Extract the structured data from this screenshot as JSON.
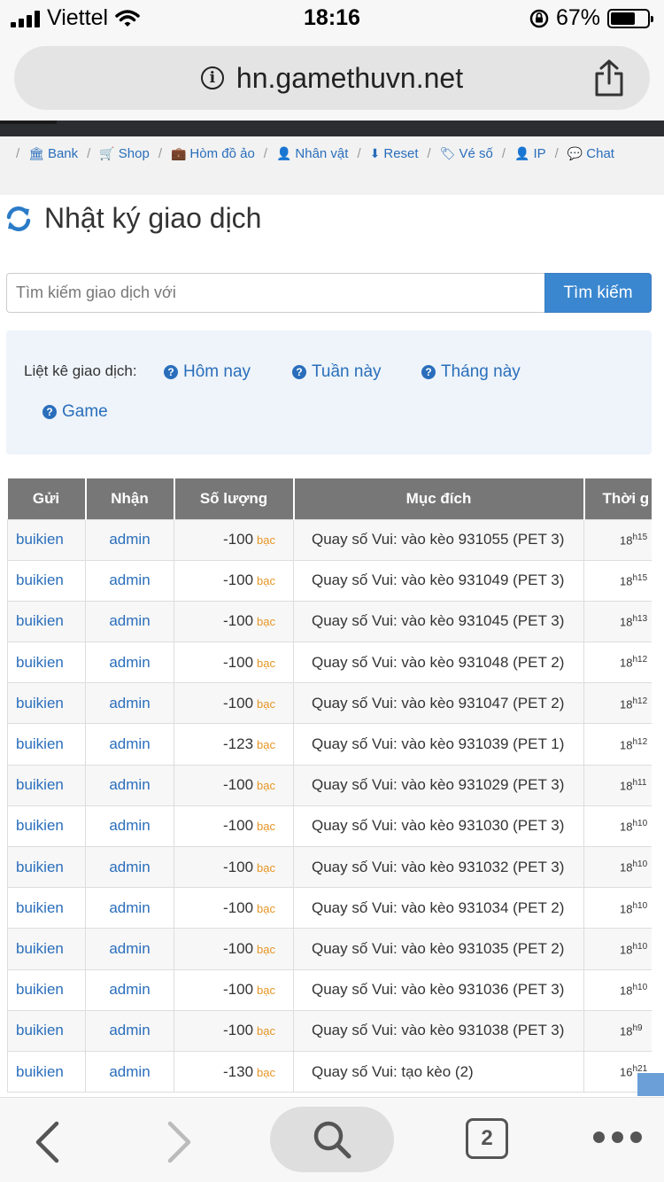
{
  "status": {
    "carrier": "Viettel",
    "time": "18:16",
    "battery_text": "67%",
    "battery_level": 0.67
  },
  "browser": {
    "url": "hn.gamethuvn.net",
    "tab_count": "2"
  },
  "nav": {
    "items": [
      {
        "label": "Bank",
        "icon": "bank-icon"
      },
      {
        "label": "Shop",
        "icon": "cart-icon"
      },
      {
        "label": "Hòm đồ ảo",
        "icon": "briefcase-icon"
      },
      {
        "label": "Nhân vật",
        "icon": "user-icon"
      },
      {
        "label": "Reset",
        "icon": "reset-icon"
      },
      {
        "label": "Vé số",
        "icon": "ticket-icon"
      },
      {
        "label": "IP",
        "icon": "ip-icon"
      },
      {
        "label": "Chat",
        "icon": "chat-icon"
      }
    ]
  },
  "page": {
    "title": "Nhật ký giao dịch"
  },
  "search": {
    "placeholder": "Tìm kiếm giao dịch với",
    "button_label": "Tìm kiếm"
  },
  "filter": {
    "label": "Liệt kê giao dịch:",
    "links": [
      "Hôm nay",
      "Tuần này",
      "Tháng này",
      "Game"
    ]
  },
  "table": {
    "headers": [
      "Gửi",
      "Nhận",
      "Số lượng",
      "Mục đích",
      "Thời g"
    ],
    "unit": "bạc",
    "rows": [
      {
        "from": "buikien",
        "to": "admin",
        "amount": "-100",
        "purpose": "Quay số Vui: vào kèo 931055 (PET 3)",
        "time_h": "18",
        "time_m": "15"
      },
      {
        "from": "buikien",
        "to": "admin",
        "amount": "-100",
        "purpose": "Quay số Vui: vào kèo 931049 (PET 3)",
        "time_h": "18",
        "time_m": "15"
      },
      {
        "from": "buikien",
        "to": "admin",
        "amount": "-100",
        "purpose": "Quay số Vui: vào kèo 931045 (PET 3)",
        "time_h": "18",
        "time_m": "13"
      },
      {
        "from": "buikien",
        "to": "admin",
        "amount": "-100",
        "purpose": "Quay số Vui: vào kèo 931048 (PET 2)",
        "time_h": "18",
        "time_m": "12"
      },
      {
        "from": "buikien",
        "to": "admin",
        "amount": "-100",
        "purpose": "Quay số Vui: vào kèo 931047 (PET 2)",
        "time_h": "18",
        "time_m": "12"
      },
      {
        "from": "buikien",
        "to": "admin",
        "amount": "-123",
        "purpose": "Quay số Vui: vào kèo 931039 (PET 1)",
        "time_h": "18",
        "time_m": "12"
      },
      {
        "from": "buikien",
        "to": "admin",
        "amount": "-100",
        "purpose": "Quay số Vui: vào kèo 931029 (PET 3)",
        "time_h": "18",
        "time_m": "11"
      },
      {
        "from": "buikien",
        "to": "admin",
        "amount": "-100",
        "purpose": "Quay số Vui: vào kèo 931030 (PET 3)",
        "time_h": "18",
        "time_m": "10"
      },
      {
        "from": "buikien",
        "to": "admin",
        "amount": "-100",
        "purpose": "Quay số Vui: vào kèo 931032 (PET 3)",
        "time_h": "18",
        "time_m": "10"
      },
      {
        "from": "buikien",
        "to": "admin",
        "amount": "-100",
        "purpose": "Quay số Vui: vào kèo 931034 (PET 2)",
        "time_h": "18",
        "time_m": "10"
      },
      {
        "from": "buikien",
        "to": "admin",
        "amount": "-100",
        "purpose": "Quay số Vui: vào kèo 931035 (PET 2)",
        "time_h": "18",
        "time_m": "10"
      },
      {
        "from": "buikien",
        "to": "admin",
        "amount": "-100",
        "purpose": "Quay số Vui: vào kèo 931036 (PET 3)",
        "time_h": "18",
        "time_m": "10"
      },
      {
        "from": "buikien",
        "to": "admin",
        "amount": "-100",
        "purpose": "Quay số Vui: vào kèo 931038 (PET 3)",
        "time_h": "18",
        "time_m": "9"
      },
      {
        "from": "buikien",
        "to": "admin",
        "amount": "-130",
        "purpose": "Quay số Vui: tạo kèo (2)",
        "time_h": "16",
        "time_m": "21"
      }
    ]
  }
}
